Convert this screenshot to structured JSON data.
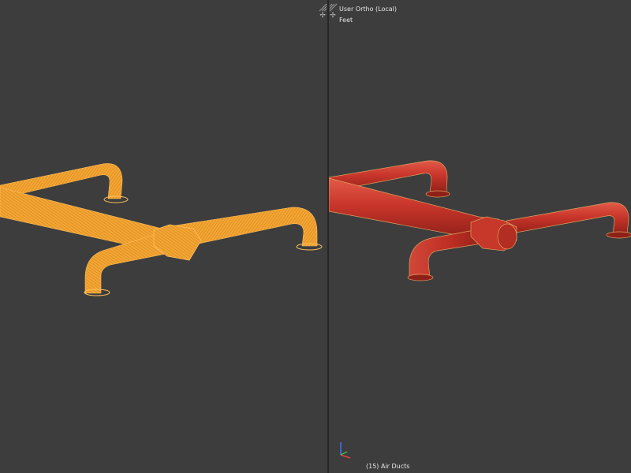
{
  "left_viewport": {
    "shading": "wireframe",
    "object_color": "#f0a030"
  },
  "right_viewport": {
    "view_label": "User Ortho (Local)",
    "units_label": "Feet",
    "object_label": "(15) Air Ducts",
    "shading": "solid",
    "object_color": "#c7372a"
  },
  "icons": {
    "corner": "corner-drag-icon",
    "split_left": "split-left-icon",
    "split_right": "split-right-icon",
    "gizmo": "axis-gizmo-icon"
  },
  "colors": {
    "viewport_bg": "#3d3d3d",
    "axis_x": "#e04040",
    "axis_y": "#40c040",
    "axis_z": "#4070ff"
  }
}
